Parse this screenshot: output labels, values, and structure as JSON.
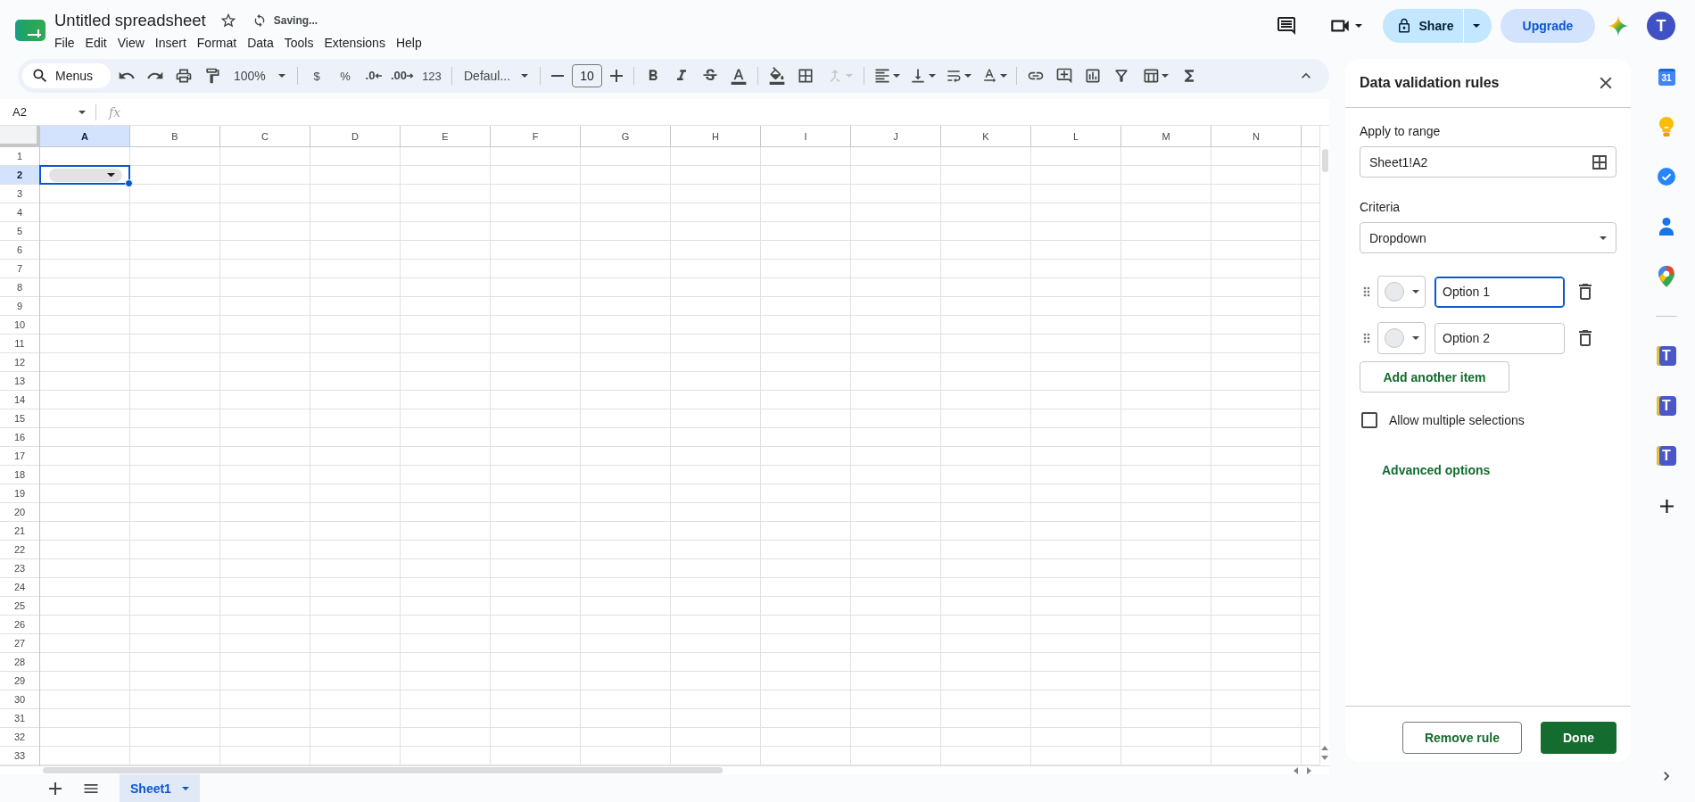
{
  "app_bar": {
    "title": "Untitled spreadsheet",
    "starred": false,
    "status": "Saving...",
    "menus": [
      "File",
      "Edit",
      "View",
      "Insert",
      "Format",
      "Data",
      "Tools",
      "Extensions",
      "Help"
    ],
    "share": "Share",
    "upgrade": "Upgrade",
    "avatar": "T"
  },
  "toolbar": {
    "search": "Menus",
    "zoom": "100%",
    "currency": "$",
    "percent": "%",
    "decrease_decimals": ".0",
    "increase_decimals": ".00",
    "number_format": "123",
    "font": "Defaul...",
    "font_size": "10",
    "merge_disabled": true
  },
  "formula_bar": {
    "cell": "A2",
    "fx": "fx"
  },
  "grid": {
    "columns": [
      {
        "label": "A",
        "selected": true
      },
      {
        "label": "B",
        "selected": false
      },
      {
        "label": "C",
        "selected": false
      },
      {
        "label": "D",
        "selected": false
      },
      {
        "label": "E",
        "selected": false
      },
      {
        "label": "F",
        "selected": false
      },
      {
        "label": "G",
        "selected": false
      },
      {
        "label": "H",
        "selected": false
      },
      {
        "label": "I",
        "selected": false
      },
      {
        "label": "J",
        "selected": false
      },
      {
        "label": "K",
        "selected": false
      },
      {
        "label": "L",
        "selected": false
      },
      {
        "label": "M",
        "selected": false
      },
      {
        "label": "N",
        "selected": false
      }
    ],
    "rows": [
      {
        "label": "1",
        "selected": false
      },
      {
        "label": "2",
        "selected": true
      },
      {
        "label": "3",
        "selected": false
      },
      {
        "label": "4",
        "selected": false
      },
      {
        "label": "5",
        "selected": false
      },
      {
        "label": "6",
        "selected": false
      },
      {
        "label": "7",
        "selected": false
      },
      {
        "label": "8",
        "selected": false
      },
      {
        "label": "9",
        "selected": false
      },
      {
        "label": "10",
        "selected": false
      },
      {
        "label": "11",
        "selected": false
      },
      {
        "label": "12",
        "selected": false
      },
      {
        "label": "13",
        "selected": false
      },
      {
        "label": "14",
        "selected": false
      },
      {
        "label": "15",
        "selected": false
      },
      {
        "label": "16",
        "selected": false
      },
      {
        "label": "17",
        "selected": false
      },
      {
        "label": "18",
        "selected": false
      },
      {
        "label": "19",
        "selected": false
      },
      {
        "label": "20",
        "selected": false
      },
      {
        "label": "21",
        "selected": false
      },
      {
        "label": "22",
        "selected": false
      },
      {
        "label": "23",
        "selected": false
      },
      {
        "label": "24",
        "selected": false
      },
      {
        "label": "25",
        "selected": false
      },
      {
        "label": "26",
        "selected": false
      },
      {
        "label": "27",
        "selected": false
      },
      {
        "label": "28",
        "selected": false
      },
      {
        "label": "29",
        "selected": false
      },
      {
        "label": "30",
        "selected": false
      },
      {
        "label": "31",
        "selected": false
      },
      {
        "label": "32",
        "selected": false
      },
      {
        "label": "33",
        "selected": false
      }
    ],
    "active_cell": {
      "kind": "dropdown"
    }
  },
  "sheet_tabs": [
    {
      "name": "Sheet1",
      "selected": true
    }
  ],
  "panel": {
    "title": "Data validation rules",
    "range_label": "Apply to range",
    "range": "Sheet1!A2",
    "criteria_label": "Criteria",
    "criteria": "Dropdown",
    "items": [
      {
        "value": "Option 1",
        "focused": true
      },
      {
        "value": "Option 2",
        "focused": false
      }
    ],
    "add_item": "Add another item",
    "allow_multiple": {
      "label": "Allow multiple selections",
      "checked": false
    },
    "advanced": "Advanced options",
    "remove": "Remove rule",
    "done": "Done"
  },
  "side_rail": {
    "apps": [
      {
        "kind": "calendar",
        "label": "31"
      },
      {
        "kind": "keep"
      },
      {
        "kind": "tasks"
      },
      {
        "kind": "contacts"
      },
      {
        "kind": "maps"
      }
    ],
    "addons": [
      {
        "label": "T"
      },
      {
        "label": "T"
      },
      {
        "label": "T"
      }
    ]
  }
}
